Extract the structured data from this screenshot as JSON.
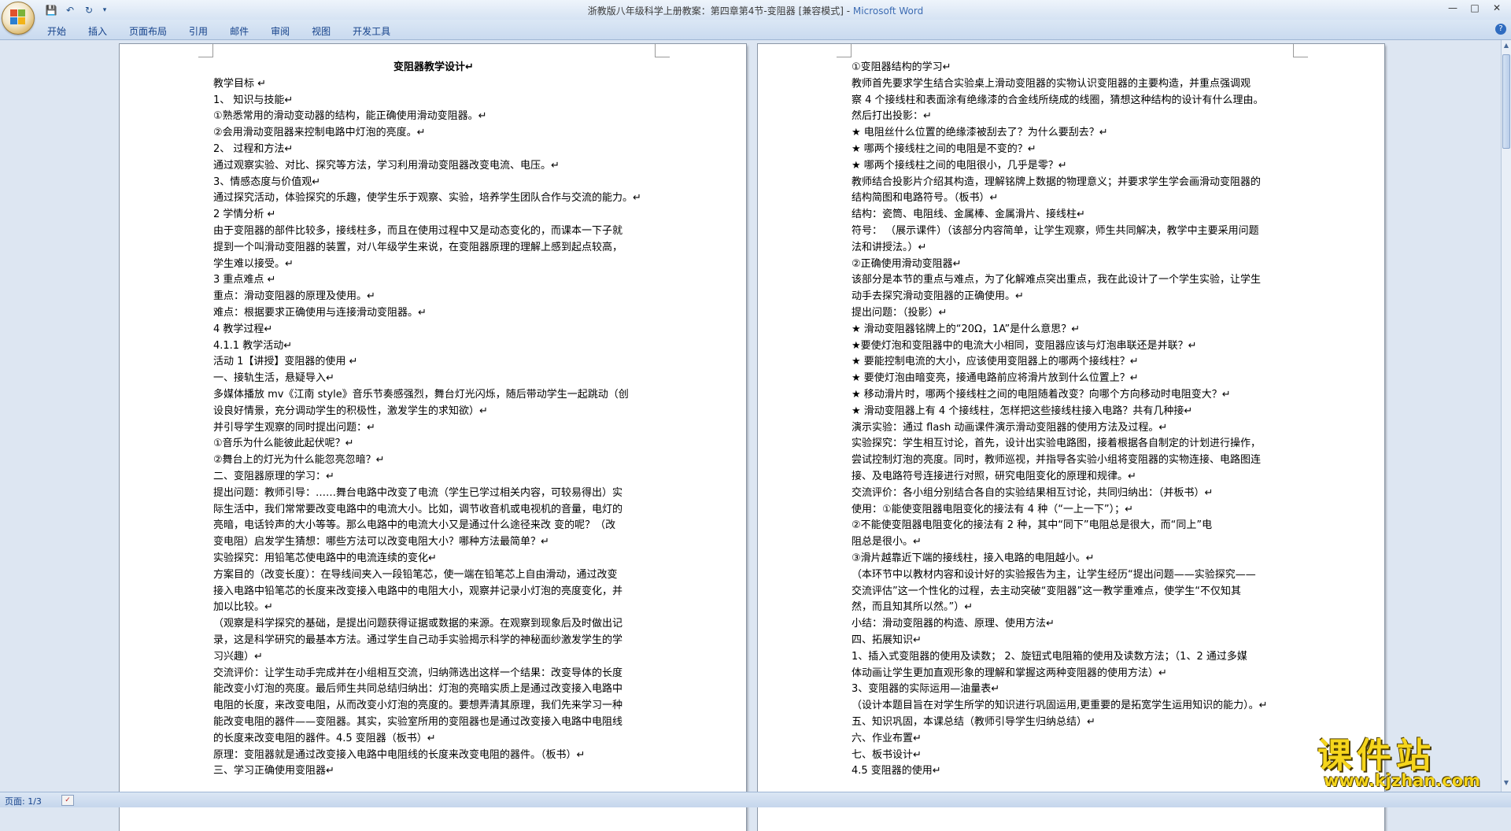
{
  "window": {
    "title": "浙教版八年级科学上册教案：第四章第4节-变阻器 [兼容模式] -",
    "app_name": "Microsoft Word"
  },
  "quick_access": {
    "save": "💾",
    "undo": "↶",
    "redo": "↻",
    "customize": "▾"
  },
  "ribbon": {
    "tabs": [
      "开始",
      "插入",
      "页面布局",
      "引用",
      "邮件",
      "审阅",
      "视图",
      "开发工具"
    ]
  },
  "statusbar": {
    "page_count": "页面: 1/3"
  },
  "watermark": {
    "text": "课件站",
    "url": "www.kjzhan.com"
  },
  "document": {
    "page1": [
      {
        "t": "变阻器教学设计↵",
        "bold": true,
        "center": true
      },
      {
        "t": "教学目标 ↵"
      },
      {
        "t": "1、      知识与技能↵"
      },
      {
        "t": "①熟悉常用的滑动变动器的结构，能正确使用滑动变阻器。↵"
      },
      {
        "t": "②会用滑动变阻器来控制电路中灯泡的亮度。↵"
      },
      {
        "t": "2、 过程和方法↵"
      },
      {
        "t": "通过观察实验、对比、探究等方法，学习利用滑动变阻器改变电流、电压。↵"
      },
      {
        "t": "3、情感态度与价值观↵"
      },
      {
        "t": "通过探究活动，体验探究的乐趣，使学生乐于观察、实验，培养学生团队合作与交流的能力。↵"
      },
      {
        "t": "2 学情分析 ↵"
      },
      {
        "t": "由于变阻器的部件比较多，接线柱多，而且在使用过程中又是动态变化的，而课本一下子就"
      },
      {
        "t": "提到一个叫滑动变阻器的装置，对八年级学生来说，在变阻器原理的理解上感到起点较高，"
      },
      {
        "t": "学生难以接受。↵"
      },
      {
        "t": "3 重点难点 ↵"
      },
      {
        "t": "重点：滑动变阻器的原理及使用。↵"
      },
      {
        "t": "难点：根据要求正确使用与连接滑动变阻器。↵"
      },
      {
        "t": "4 教学过程↵"
      },
      {
        "t": "4.1.1 教学活动↵"
      },
      {
        "t": "活动 1【讲授】变阻器的使用 ↵"
      },
      {
        "t": "一、接轨生活，悬疑导入↵"
      },
      {
        "t": "多媒体播放 mv《江南 style》音乐节奏感强烈，舞台灯光闪烁，随后带动学生一起跳动（创"
      },
      {
        "t": "设良好情景，充分调动学生的积极性，激发学生的求知欲）↵"
      },
      {
        "t": "并引导学生观察的同时提出问题：↵"
      },
      {
        "t": "①音乐为什么能彼此起伏呢？↵"
      },
      {
        "t": "②舞台上的灯光为什么能忽亮忽暗？↵"
      },
      {
        "t": "二、变阻器原理的学习：↵"
      },
      {
        "t": "提出问题：教师引导：……舞台电路中改变了电流（学生已学过相关内容，可较易得出）实"
      },
      {
        "t": "际生活中，我们常常要改变电路中的电流大小。比如，调节收音机或电视机的音量，电灯的"
      },
      {
        "t": "亮暗，电话铃声的大小等等。那么电路中的电流大小又是通过什么途径来改 变的呢？（改"
      },
      {
        "t": "变电阻）启发学生猜想：哪些方法可以改变电阻大小？哪种方法最简单？↵"
      },
      {
        "t": "实验探究：用铅笔芯使电路中的电流连续的变化↵"
      },
      {
        "t": "方案目的（改变长度）：在导线间夹入一段铅笔芯，使一端在铅笔芯上自由滑动，通过改变"
      },
      {
        "t": "接入电路中铅笔芯的长度来改变接入电路中的电阻大小，观察并记录小灯泡的亮度变化，并"
      },
      {
        "t": "加以比较。↵"
      },
      {
        "t": "（观察是科学探究的基础，是提出问题获得证据或数据的来源。在观察到现象后及时做出记"
      },
      {
        "t": "录，这是科学研究的最基本方法。通过学生自己动手实验揭示科学的神秘面纱激发学生的学"
      },
      {
        "t": "习兴趣）↵"
      },
      {
        "t": "交流评价：让学生动手完成并在小组相互交流，归纳筛选出这样一个结果：改变导体的长度"
      },
      {
        "t": "能改变小灯泡的亮度。最后师生共同总结归纳出：灯泡的亮暗实质上是通过改变接入电路中"
      },
      {
        "t": "电阻的长度，来改变电阻，从而改变小灯泡的亮度的。要想弄清其原理，我们先来学习一种"
      },
      {
        "t": "能改变电阻的器件——变阻器。其实，实验室所用的变阻器也是通过改变接入电路中电阻线"
      },
      {
        "t": "的长度来改变电阻的器件。4.5   变阻器（板书）↵"
      },
      {
        "t": "原理：变阻器就是通过改变接入电路中电阻线的长度来改变电阻的器件。（板书）↵"
      },
      {
        "t": "三、学习正确使用变阻器↵"
      }
    ],
    "page2": [
      {
        "t": "①变阻器结构的学习↵"
      },
      {
        "t": "   教师首先要求学生结合实验桌上滑动变阻器的实物认识变阻器的主要构造，并重点强调观"
      },
      {
        "t": "察 4 个接线柱和表面涂有绝缘漆的合金线所绕成的线圈，猜想这种结构的设计有什么理由。"
      },
      {
        "t": "然后打出投影：↵"
      },
      {
        "t": "★ 电阻丝什么位置的绝缘漆被刮去了？为什么要刮去？↵"
      },
      {
        "t": "★ 哪两个接线柱之间的电阻是不变的？↵"
      },
      {
        "t": "★ 哪两个接线柱之间的电阻很小，几乎是零？↵"
      },
      {
        "t": "教师结合投影片介绍其构造，理解铭牌上数据的物理意义；并要求学生学会画滑动变阻器的"
      },
      {
        "t": "结构简图和电路符号。（板书）↵"
      },
      {
        "t": "结构：瓷筒、电阻线、金属棒、金属滑片、接线柱↵"
      },
      {
        "t": "符号：  （展示课件）（该部分内容简单，让学生观察，师生共同解决，教学中主要采用问题"
      },
      {
        "t": "法和讲授法。）↵"
      },
      {
        "t": "②正确使用滑动变阻器↵"
      },
      {
        "t": "该部分是本节的重点与难点，为了化解难点突出重点，我在此设计了一个学生实验，让学生"
      },
      {
        "t": "动手去探究滑动变阻器的正确使用。↵"
      },
      {
        "t": "提出问题：（投影）↵"
      },
      {
        "t": "★ 滑动变阻器铭牌上的“20Ω，1A”是什么意思？↵"
      },
      {
        "t": "★要使灯泡和变阻器中的电流大小相同，变阻器应该与灯泡串联还是并联？↵"
      },
      {
        "t": "★ 要能控制电流的大小，应该使用变阻器上的哪两个接线柱？↵"
      },
      {
        "t": "★ 要使灯泡由暗变亮，接通电路前应将滑片放到什么位置上？↵"
      },
      {
        "t": "★ 移动滑片时，哪两个接线柱之间的电阻随着改变？向哪个方向移动时电阻变大？↵"
      },
      {
        "t": "★ 滑动变阻器上有 4 个接线柱，怎样把这些接线柱接入电路？共有几种接↵"
      },
      {
        "t": "演示实验：通过 flash 动画课件演示滑动变阻器的使用方法及过程。↵"
      },
      {
        "t": "实验探究：学生相互讨论，首先，设计出实验电路图，接着根据各自制定的计划进行操作，"
      },
      {
        "t": "尝试控制灯泡的亮度。同时，教师巡视，并指导各实验小组将变阻器的实物连接、电路图连"
      },
      {
        "t": "接、及电路符号连接进行对照，研究电阻变化的原理和规律。↵"
      },
      {
        "t": "交流评价：各小组分别结合各自的实验结果相互讨论，共同归纳出：（并板书）↵"
      },
      {
        "t": "使用：①能使变阻器电阻变化的接法有 4 种（“一上一下”）；↵"
      },
      {
        "t": "        ②不能使变阻器电阻变化的接法有 2 种，其中“同下”电阻总是很大，而“同上”电"
      },
      {
        "t": "阻总是很小。↵"
      },
      {
        "t": "③滑片越靠近下端的接线柱，接入电路的电阻越小。↵"
      },
      {
        "t": "（本环节中以教材内容和设计好的实验报告为主，让学生经历“提出问题——实验探究——"
      },
      {
        "t": "交流评估”这一个性化的过程，去主动突破“变阻器”这一教学重难点，使学生“不仅知其"
      },
      {
        "t": "然，而且知其所以然。”）↵"
      },
      {
        "t": "小结：滑动变阻器的构造、原理、使用方法↵"
      },
      {
        "t": "四、拓展知识↵"
      },
      {
        "t": "1、插入式变阻器的使用及读数；    2、旋钮式电阻箱的使用及读数方法；（1、2 通过多媒"
      },
      {
        "t": "体动画让学生更加直观形象的理解和掌握这两种变阻器的使用方法）↵"
      },
      {
        "t": "3、变阻器的实际运用—油量表↵"
      },
      {
        "t": "（设计本题目旨在对学生所学的知识进行巩固运用,更重要的是拓宽学生运用知识的能力）。↵"
      },
      {
        "t": "五、知识巩固，本课总结（教师引导学生归纳总结）↵"
      },
      {
        "t": "六、作业布置↵"
      },
      {
        "t": "七、板书设计↵"
      },
      {
        "t": "4.5 变阻器的使用↵"
      }
    ]
  }
}
